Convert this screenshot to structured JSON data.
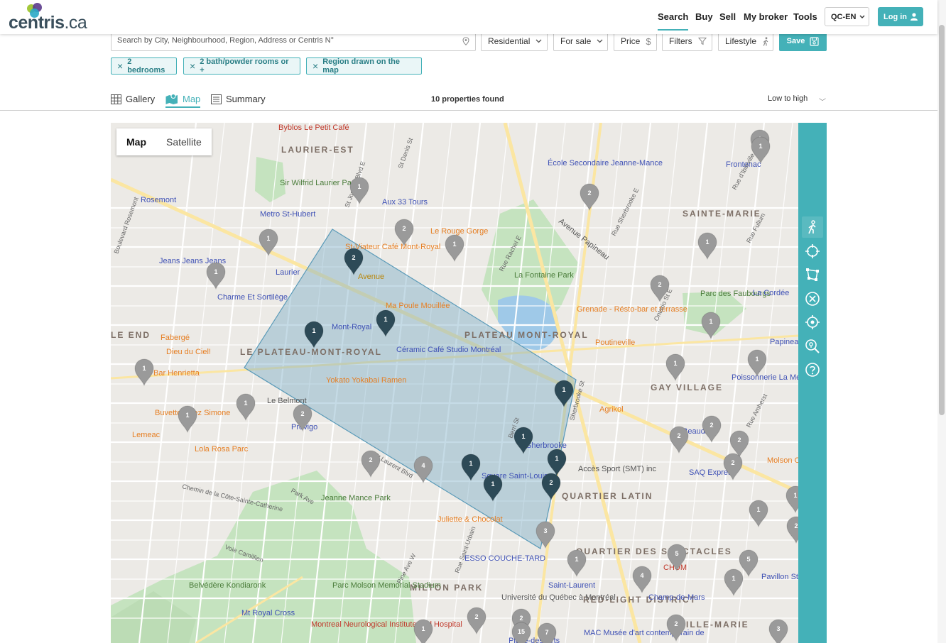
{
  "header": {
    "logo": {
      "name": "centris",
      "ext": ".ca"
    },
    "nav": [
      "Search",
      "Buy",
      "Sell",
      "My broker",
      "Tools"
    ],
    "language": "QC-EN",
    "login": "Log in"
  },
  "search": {
    "placeholder": "Search by City, Neighbourhood, Region, Address or Centris N°",
    "property_type": "Residential",
    "transaction": "For sale",
    "price": "Price",
    "filters": "Filters",
    "lifestyle": "Lifestyle",
    "save": "Save"
  },
  "chips": [
    "2 bedrooms",
    "2 bath/powder rooms or +",
    "Region drawn on the map"
  ],
  "views": {
    "gallery": "Gallery",
    "map": "Map",
    "summary": "Summary"
  },
  "results": {
    "found": "10 properties found",
    "sort": "Low to high"
  },
  "map": {
    "type_map": "Map",
    "type_satellite": "Satellite",
    "districts": [
      "LAURIER-EST",
      "SAINTE-MARIE",
      "LE PLATEAU-MONT-ROYAL",
      "PLATEAU MONT-ROYAL",
      "GAY VILLAGE",
      "QUARTIER LATIN",
      "QUARTIER DES SPECTACLES",
      "MILTON PARK",
      "RED-LIGHT DISTRICT",
      "VILLE-MARIE",
      "LE END"
    ],
    "places": [
      "Byblos Le Petit Café",
      "École Secondaire Jeanne-Mance",
      "Frontenac",
      "Sir Wilfrid Laurier Park",
      "Rosemont",
      "Aux 33 Tours",
      "Metro St-Hubert",
      "St-Viateur Café Mont-Royal",
      "Le Rouge Gorge",
      "Avenue",
      "Jeans Jeans Jeans",
      "Laurier",
      "La Fontaine Park",
      "Parc des Faubourgs",
      "La Cordée",
      "Charme Et Sortilège",
      "Ma Poule Mouillée",
      "Grenade - Résto-bar et terrasse",
      "Mont-Royal",
      "Fabergé",
      "Dieu du Ciel!",
      "Céramic Café Studio Montréal",
      "Papineau",
      "Bar Henrietta",
      "Yokato Yokabai Ramen",
      "Poutineville",
      "Poissonnerie La Mer",
      "Le Belmont",
      "Agrikol",
      "Buvette Chez Simone",
      "Lemeac",
      "Provigo",
      "Lola Rosa Parc",
      "Sherbrooke",
      "Square Saint-Louis",
      "Accès Sport (SMT) inc",
      "SAQ Express",
      "Beaudry",
      "Molson Co",
      "Jeanne Mance Park",
      "Juliette & Chocolat",
      "ESSO COUCHE-TARD",
      "Saint-Laurent",
      "CHUM",
      "Champ-de-Mars",
      "Belvédère Kondiaronk",
      "Parc Molson Memorial Stadium",
      "Montreal Neurological Institute and Hospital",
      "Université du Québec à Montréal",
      "Mt Royal Cross",
      "MAC Musée d'art contemporain de",
      "Place-des-Arts",
      "Pavillon St",
      "Pine Ave W",
      "Sherbrooke St",
      "Avenue Papineau",
      "Park Ave",
      "St Laurent Blvd",
      "Chemin de la Côte-Sainte-Catherine",
      "Voie Camillien",
      "Rue Rachel E",
      "Rue d'Iberville",
      "Ontario St E",
      "Berri St",
      "St Denis St",
      "Rue Saint-Urbain",
      "Rue Sherbrooke E",
      "Rue Amherst",
      "Rue Fullum",
      "St Joseph Blvd E",
      "Boulevard Rosemont"
    ],
    "selected_markers": [
      "2",
      "1",
      "1",
      "1",
      "1",
      "1",
      "1",
      "1",
      "2"
    ],
    "other_markers": [
      "1",
      "1",
      "1",
      "2",
      "1",
      "2",
      "1",
      "1",
      "2",
      "1",
      "1",
      "1",
      "1",
      "1",
      "1",
      "2",
      "2",
      "4",
      "2",
      "2",
      "2",
      "2",
      "1",
      "1",
      "3",
      "1",
      "5",
      "5",
      "4",
      "1",
      "2",
      "3",
      "2",
      "2",
      "15",
      "7",
      "1",
      "2",
      "1"
    ]
  },
  "tools": [
    "walk-score-icon",
    "crosshair-icon",
    "draw-region-icon",
    "clear-icon",
    "locate-icon",
    "search-map-icon",
    "help-icon"
  ],
  "colors": {
    "accent": "#44b1b8",
    "accent_dark": "#2a7f86",
    "region_fill": "#7fb0c8",
    "selected_pin": "#2d4a57",
    "other_pin": "#9a9a9a"
  }
}
